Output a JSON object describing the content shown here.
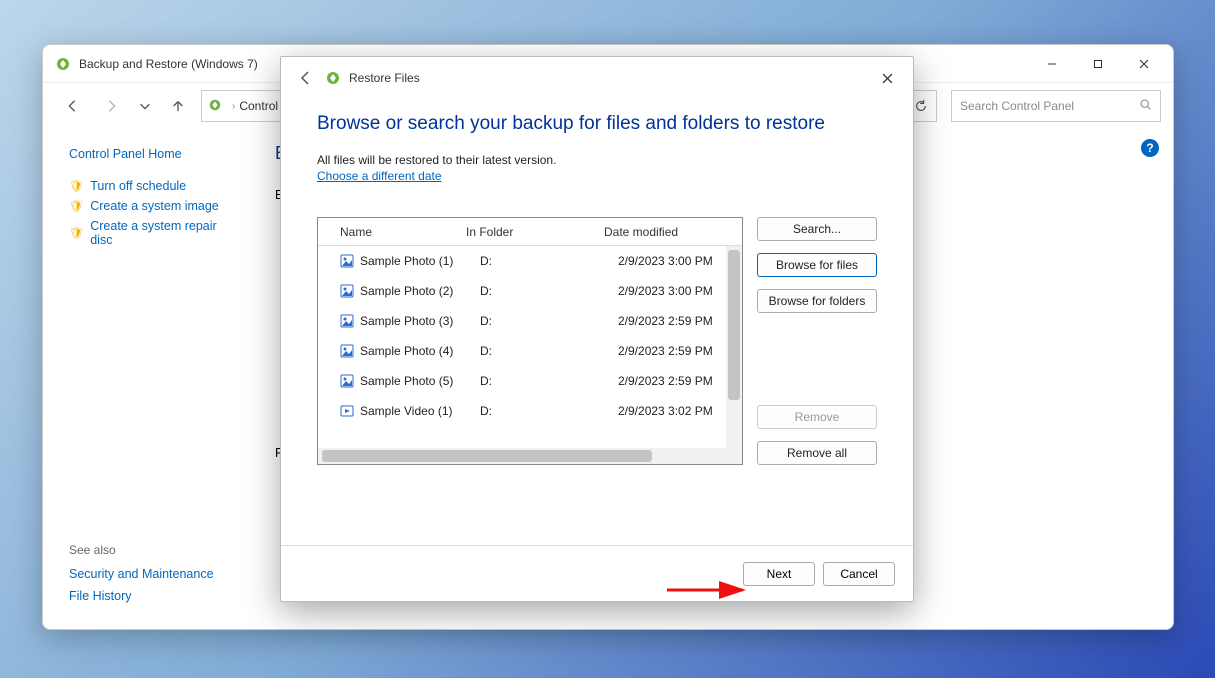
{
  "cp": {
    "title": "Backup and Restore (Windows 7)",
    "breadcrumb": {
      "root_label": "Control Pa",
      "chevron": "›"
    },
    "refresh_tooltip": "Refresh",
    "search_placeholder": "Search Control Panel",
    "help_badge": "?",
    "sidebar": {
      "home": "Control Panel Home",
      "items": [
        {
          "label": "Turn off schedule"
        },
        {
          "label": "Create a system image"
        },
        {
          "label": "Create a system repair disc"
        }
      ],
      "see_also_header": "See also",
      "see_also": [
        {
          "label": "Security and Maintenance"
        },
        {
          "label": "File History"
        }
      ]
    },
    "main": {
      "partial_heading_1": "B",
      "partial_heading_2": "Ba",
      "partial_heading_3": "Re"
    }
  },
  "wizard": {
    "window_title": "Restore Files",
    "heading": "Browse or search your backup for files and folders to restore",
    "description": "All files will be restored to their latest version.",
    "choose_date_link": "Choose a different date",
    "columns": {
      "name": "Name",
      "in_folder": "In Folder",
      "date": "Date modified"
    },
    "rows": [
      {
        "name": "Sample Photo (1)",
        "folder": "D:",
        "date": "2/9/2023 3:00 PM",
        "kind": "image"
      },
      {
        "name": "Sample Photo (2)",
        "folder": "D:",
        "date": "2/9/2023 3:00 PM",
        "kind": "image"
      },
      {
        "name": "Sample Photo (3)",
        "folder": "D:",
        "date": "2/9/2023 2:59 PM",
        "kind": "image"
      },
      {
        "name": "Sample Photo (4)",
        "folder": "D:",
        "date": "2/9/2023 2:59 PM",
        "kind": "image"
      },
      {
        "name": "Sample Photo (5)",
        "folder": "D:",
        "date": "2/9/2023 2:59 PM",
        "kind": "image"
      },
      {
        "name": "Sample Video (1)",
        "folder": "D:",
        "date": "2/9/2023 3:02 PM",
        "kind": "video"
      }
    ],
    "side_buttons": {
      "search": "Search...",
      "browse_files": "Browse for files",
      "browse_folders": "Browse for folders",
      "remove": "Remove",
      "remove_all": "Remove all"
    },
    "footer": {
      "next": "Next",
      "cancel": "Cancel"
    }
  }
}
